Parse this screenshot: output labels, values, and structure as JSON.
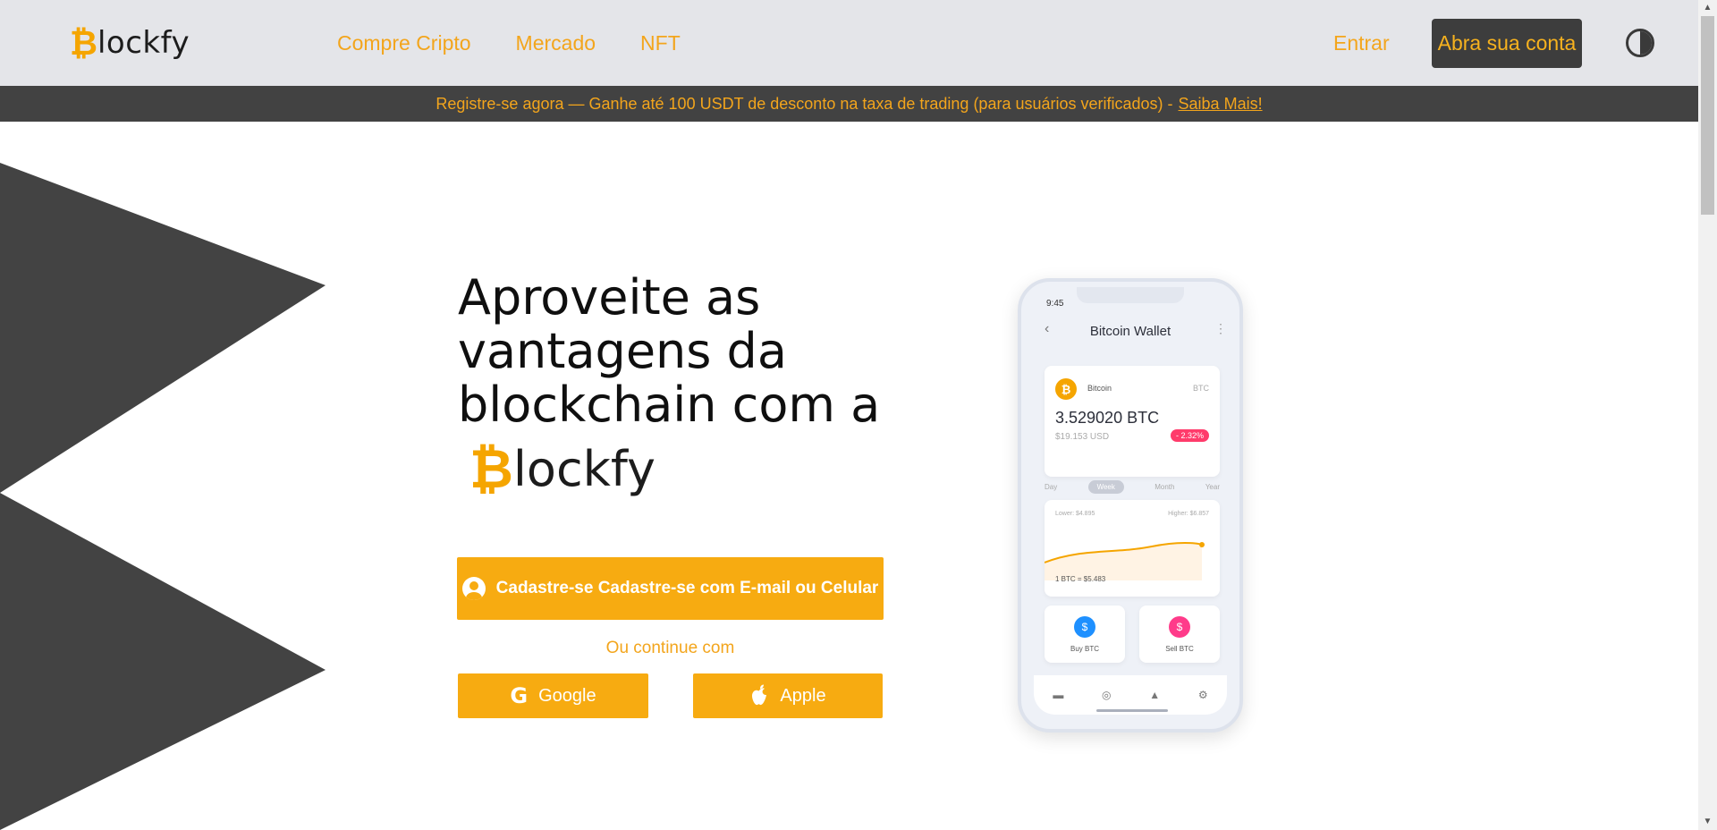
{
  "header": {
    "logo_coin": "₿",
    "logo_word": "lockfy",
    "nav": [
      "Compre Cripto",
      "Mercado",
      "NFT"
    ],
    "login_label": "Entrar",
    "signup_label": "Abra sua conta",
    "theme_icon": "contrast-icon"
  },
  "banner": {
    "text": "Registre-se agora — Ganhe até 100 USDT de desconto na taxa de trading (para usuários verificados) -",
    "link": "Saiba Mais!"
  },
  "hero": {
    "title": "Aproveite as vantagens da blockchain com a",
    "logo_coin": "₿",
    "logo_word": "lockfy",
    "cta_label": "Cadastre-se Cadastre-se com E-mail ou Celular",
    "or_text": "Ou continue com",
    "google_label": "Google",
    "apple_label": "Apple"
  },
  "phone": {
    "time": "9:45",
    "title": "Bitcoin Wallet",
    "coin_name": "Bitcoin",
    "coin_symbol": "BTC",
    "amount": "3.529020 BTC",
    "usd": "$19.153 USD",
    "change": "- 2.32%",
    "tabs": [
      "Day",
      "Week",
      "Month",
      "Year"
    ],
    "lower": "Lower: $4.895",
    "higher": "Higher: $6.857",
    "rate": "1 BTC = $5.483",
    "buy_label": "Buy BTC",
    "sell_label": "Sell BTC"
  },
  "colors": {
    "accent": "#f7ab11",
    "header_bg": "#e4e5e9",
    "banner_bg": "#424242",
    "dark_button": "#3d3d3d"
  }
}
